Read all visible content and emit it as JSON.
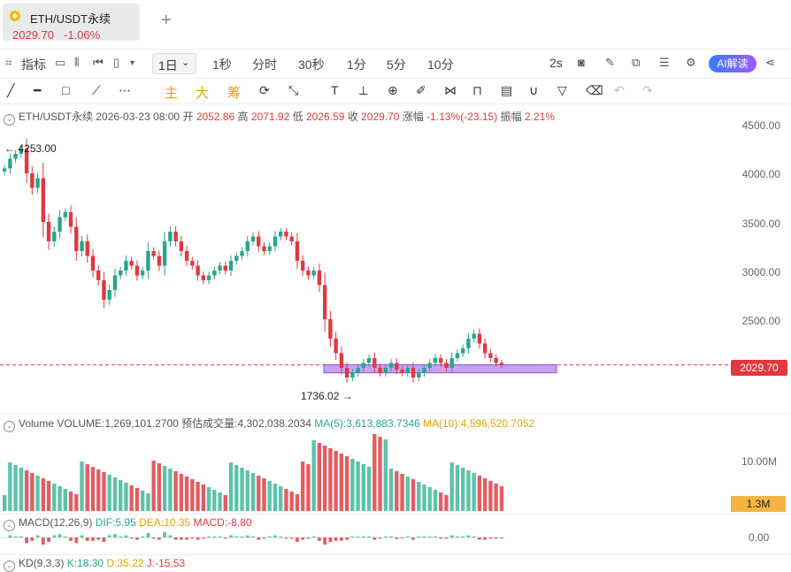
{
  "tab": {
    "icon": "eth-coin-icon",
    "title": "ETH/USDT永续",
    "price": "2029.70",
    "change": "-1.06%",
    "add": "+"
  },
  "toolbar": {
    "indicator_label": "指标",
    "period_selected": "1日",
    "periods": [
      "1秒",
      "分时",
      "30秒",
      "1分",
      "5分",
      "10分"
    ],
    "refresh": "2s",
    "ai_button": "AI解读"
  },
  "drawbar": {
    "main": "主",
    "big": "大",
    "chip": "筹"
  },
  "info": {
    "symbol": "ETH/USDT永续",
    "datetime": "2026-03-23 08:00",
    "open_label": "开",
    "open": "2052.86",
    "high_label": "高",
    "high": "2071.92",
    "low_label": "低",
    "low": "2026.59",
    "close_label": "收",
    "close": "2029.70",
    "change_label": "涨幅",
    "change": "-1.13%(-23.15)",
    "amp_label": "振幅",
    "amp": "2.21%"
  },
  "chart_data": {
    "type": "candlestick",
    "y_ticks": [
      "4500.00",
      "4000.00",
      "3500.00",
      "3000.00",
      "2500.00"
    ],
    "high_marker": "4253.00",
    "low_marker": "1736.02",
    "last_price": "2029.70",
    "closes": [
      4050,
      4150,
      4200,
      4253,
      4000,
      3850,
      3950,
      3500,
      3300,
      3400,
      3550,
      3600,
      3450,
      3200,
      3300,
      3150,
      3000,
      2900,
      2700,
      2800,
      2950,
      3000,
      3100,
      3050,
      2950,
      3000,
      3200,
      3150,
      3050,
      3300,
      3400,
      3300,
      3200,
      3100,
      3050,
      2950,
      2900,
      2950,
      3000,
      3050,
      3000,
      3100,
      3150,
      3200,
      3300,
      3350,
      3250,
      3200,
      3250,
      3350,
      3400,
      3350,
      3300,
      3100,
      3000,
      2950,
      3000,
      2850,
      2500,
      2300,
      2150,
      2000,
      1900,
      1950,
      2000,
      2050,
      2100,
      2000,
      1950,
      2000,
      2050,
      1980,
      1950,
      2000,
      1900,
      1950,
      2000,
      2050,
      2100,
      2050,
      2000,
      2100,
      2150,
      2200,
      2300,
      2350,
      2250,
      2150,
      2100,
      2050,
      2029.7
    ],
    "volume": {
      "label": "Volume",
      "volume": "VOLUME:1,269,101.2700",
      "est": "预估成交量:4,302,038.2034",
      "ma5": "MA(5):3,613,883.7346",
      "ma10": "MA(10):4,596,520.7052",
      "axis_label": "10.00M",
      "tag": "1.3M"
    },
    "macd": {
      "label": "MACD(12,26,9)",
      "dif": "DIF:5.95",
      "dea": "DEA:10.35",
      "macd": "MACD:-8.80",
      "axis_label": "0.00"
    },
    "kd": {
      "label": "KD(9,3,3)",
      "k": "K:18.30",
      "d": "D:35.22",
      "j": "J:-15.53"
    }
  }
}
